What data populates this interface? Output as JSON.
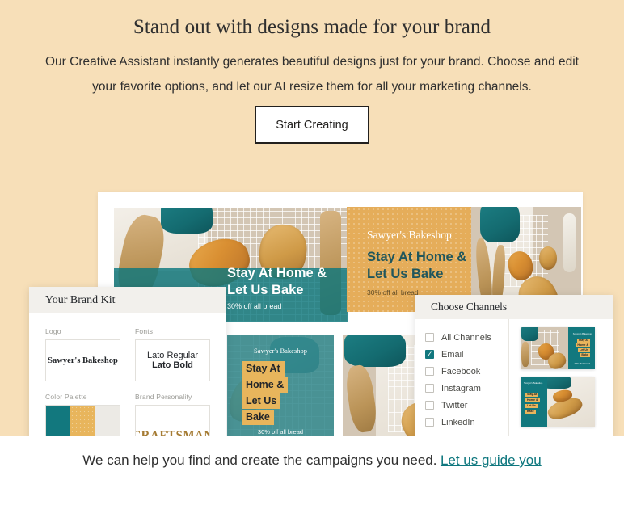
{
  "hero": {
    "title": "Stand out with designs made for your brand",
    "subtitle": "Our Creative Assistant instantly generates beautiful designs just for your brand. Choose and edit your favorite options, and let our AI resize them for all your marketing channels.",
    "cta_label": "Start Creating",
    "background_color": "#f7dfb8"
  },
  "designs": {
    "brand_name": "Sawyer's Bakeshop",
    "headline_line1": "Stay At Home &",
    "headline_line2": "Let Us Bake",
    "headline_full": "Stay At Home & Let Us Bake",
    "offer": "30% off all bread",
    "badge_lines": [
      "Stay At",
      "Home &",
      "Let Us",
      "Bake"
    ],
    "teal": "#12787e",
    "gold": "#e8b55c"
  },
  "brand_kit": {
    "title": "Your Brand Kit",
    "logo_label": "Logo",
    "logo_value": "Sawyer's Bakeshop",
    "fonts_label": "Fonts",
    "font_regular": "Lato Regular",
    "font_bold": "Lato Bold",
    "palette_label": "Color Palette",
    "palette_colors": [
      "#12787e",
      "#e8b55c",
      "#eceae5",
      "#1f4a45"
    ],
    "personality_label": "Brand Personality",
    "personality_value": "CRAFTSMAN"
  },
  "channels": {
    "title": "Choose Channels",
    "items": [
      {
        "label": "All Channels",
        "checked": false
      },
      {
        "label": "Email",
        "checked": true
      },
      {
        "label": "Facebook",
        "checked": false
      },
      {
        "label": "Instagram",
        "checked": false
      },
      {
        "label": "Twitter",
        "checked": false
      },
      {
        "label": "LinkedIn",
        "checked": false
      }
    ],
    "check_glyph": "✓",
    "accent_color": "#12787e"
  },
  "footer": {
    "text": "We can help you find and create the campaigns you need.",
    "link_label": "Let us guide you",
    "link_color": "#0e777e"
  }
}
